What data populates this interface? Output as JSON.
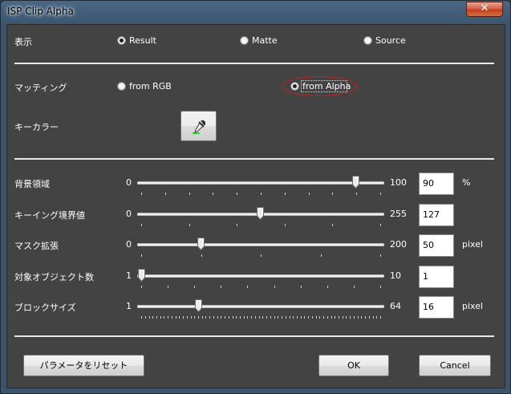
{
  "window": {
    "title": "ISP Clip Alpha",
    "close_glyph": "✕"
  },
  "display": {
    "label": "表示",
    "options": [
      {
        "label": "Result",
        "selected": true
      },
      {
        "label": "Matte",
        "selected": false
      },
      {
        "label": "Source",
        "selected": false
      }
    ]
  },
  "matting": {
    "label": "マッティング",
    "options": [
      {
        "label": "from RGB",
        "selected": false
      },
      {
        "label": "from Alpha",
        "selected": true
      }
    ]
  },
  "key_color": {
    "label": "キーカラー",
    "icon": "eyedropper-icon"
  },
  "sliders": [
    {
      "label": "背景領域",
      "min": "0",
      "max": "100",
      "value": "90",
      "unit": "%",
      "fraction": 0.9,
      "ticks": 11
    },
    {
      "label": "キーイング境界値",
      "min": "0",
      "max": "255",
      "value": "127",
      "unit": "",
      "fraction": 0.498,
      "ticks": 6
    },
    {
      "label": "マスク拡張",
      "min": "0",
      "max": "200",
      "value": "50",
      "unit": "pixel",
      "fraction": 0.25,
      "ticks": 5
    },
    {
      "label": "対象オブジェクト数",
      "min": "1",
      "max": "10",
      "value": "1",
      "unit": "",
      "fraction": 0.0,
      "ticks": 10
    },
    {
      "label": "ブロックサイズ",
      "min": "1",
      "max": "64",
      "value": "16",
      "unit": "pixel",
      "fraction": 0.238,
      "ticks": 64
    }
  ],
  "buttons": {
    "reset": "パラメータをリセット",
    "ok": "OK",
    "cancel": "Cancel"
  }
}
